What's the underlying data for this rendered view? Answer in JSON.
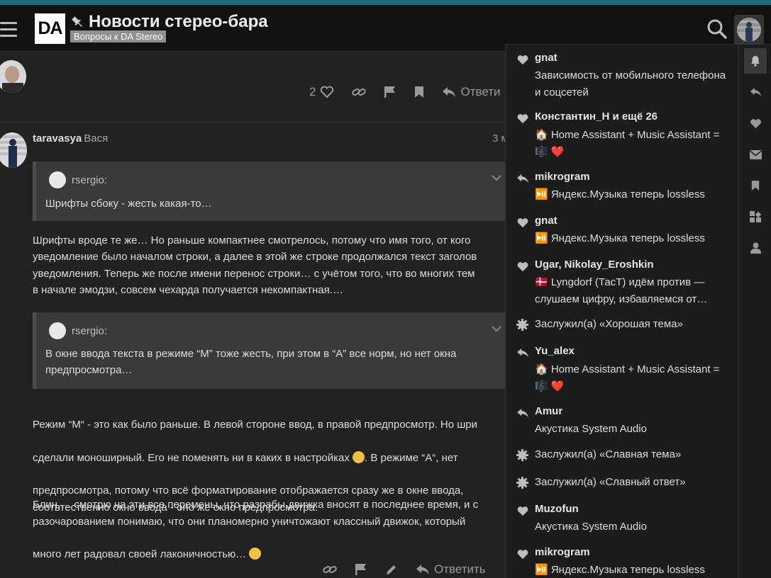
{
  "header": {
    "logo_text": "DA",
    "title": "Новости стерео-бара",
    "category": "Вопросы к DA Stereo"
  },
  "post1": {
    "likes": "2",
    "reply_label": "Ответи"
  },
  "post2": {
    "username": "taravasya",
    "fullname": "Вася",
    "date": "3 м",
    "quote1": {
      "author": "rsergio:",
      "text": "Шрифты сбоку - жесть какая-то…"
    },
    "para1": "Шрифты вроде те же… Но раньше компактнее смотрелось, потому что имя того, от кого\nуведомление было началом строки, а далее в этой же строке продолжался текст заголов\nуведомления. Теперь же после имени перенос строки… с учётом того, что во многих тем\nв начале эмодзи, совсем чехарда получается некомпактная.…",
    "quote2": {
      "author": "rsergio:",
      "text_line1": "В окне ввода текста в режиме “M” тоже жесть, при этом в “A” все норм, но нет окна",
      "text_line2": "предпросмотра…"
    },
    "para2_line1": "Режим “M“ - это как было раньше. В левой стороне ввод, в правой предпросмотр. Но шри",
    "para2_line2a": "сделали моноширный. Его не поменять ни в каких в настройках ",
    "para2_line2b": ". В режиме “A“, нет",
    "para2_rest": "предпросмотра, потому что всё форматирование отображается сразу же в окне ввода,\nсоотвтественно окно ввода - оно же окно предпросмотра.",
    "para3_lines": "Блин…. смотрю на эти все перемены, что разрабы движка вносят в последнее время, и с\nразочарованием понимаю, что они планомерно уничтожают классный движок, который",
    "para3_last": "много лет радовал своей лаконичностью… ",
    "reply_label": "Ответить"
  },
  "notifications": [
    {
      "type": "like",
      "user": "gnat",
      "body": "Зависимость от мобильного телефона и соцсетей"
    },
    {
      "type": "like",
      "user": "Константин_H и ещё 26",
      "body": "🏠 Home Assistant + Music Assistant = 🎼 ❤️"
    },
    {
      "type": "reply",
      "user": "mikrogram",
      "body": "⏯️ Яндекс.Музыка теперь lossless"
    },
    {
      "type": "like",
      "user": "gnat",
      "body": "⏯️ Яндекс.Музыка теперь lossless"
    },
    {
      "type": "like",
      "user": "Ugar, Nikolay_Eroshkin",
      "body": "🇩🇰 Lyngdorf (ТасТ) идём против — слушаем цифру, избавляемся от…"
    },
    {
      "type": "badge",
      "text": "Заслужил(а) «Хорошая тема»"
    },
    {
      "type": "reply",
      "user": "Yu_alex",
      "body": "🏠 Home Assistant + Music Assistant = 🎼 ❤️"
    },
    {
      "type": "reply",
      "user": "Amur",
      "body": "Акустика System Audio"
    },
    {
      "type": "badge",
      "text": "Заслужил(а) «Славная тема»"
    },
    {
      "type": "badge",
      "text": "Заслужил(а) «Славный ответ»"
    },
    {
      "type": "like",
      "user": "Muzofun",
      "body": "Акустика System Audio"
    },
    {
      "type": "like",
      "user": "mikrogram",
      "body": "⏯️ Яндекс.Музыка теперь lossless"
    }
  ],
  "menu_tabs": [
    "bell-icon",
    "reply-icon",
    "heart-icon",
    "envelope-icon",
    "bookmark-icon",
    "badge-icon",
    "user-icon"
  ],
  "colors": {
    "background": "#222222",
    "header": "#111111",
    "accent_strip": "#1a6a78",
    "quote_bg": "#3a3a3a",
    "menu_bg": "#1c1c1c"
  }
}
